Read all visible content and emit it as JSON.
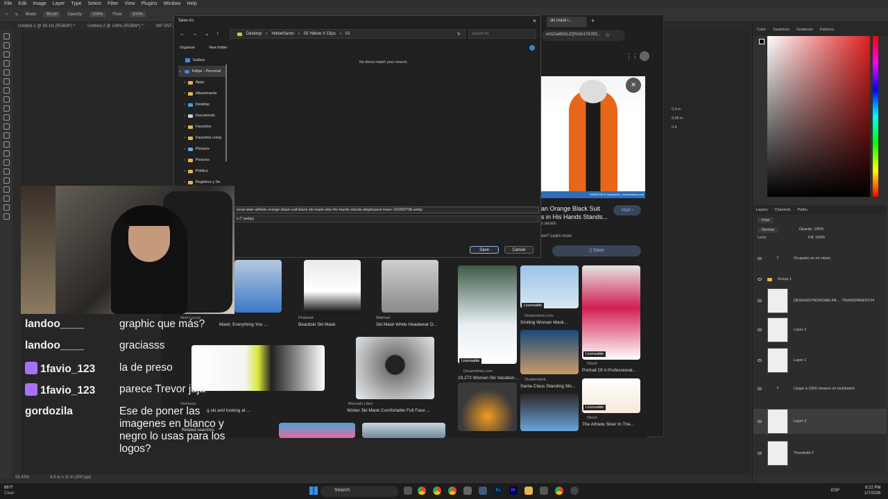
{
  "ps": {
    "menu": [
      "File",
      "Edit",
      "Image",
      "Layer",
      "Type",
      "Select",
      "Filter",
      "View",
      "Plugins",
      "Window",
      "Help"
    ],
    "opts": [
      "Mode:",
      "Brush",
      "Opacity:",
      "100%",
      "Flow:",
      "100%"
    ],
    "docs": [
      "Untitled-1 @ 39.1% (RGB/8*) *",
      "Untitled-2 @ 149% (RGB/8*) *",
      "WP SNT..."
    ],
    "status_zoom": "55.42%",
    "status_doc": "8.5 in x 11 in (300 ppi)",
    "panel_tabs": [
      "Color",
      "Swatches",
      "Gradients",
      "Patterns"
    ],
    "layers_tabs": [
      "Layers",
      "Channels",
      "Paths"
    ],
    "layers_kind": "Kind",
    "blend": "Normal",
    "opacity": "Opacity: 100%",
    "lock": "Lock:",
    "fill": "Fill: 100%",
    "layers": [
      "Ocupado en mi vision",
      "Group 1",
      "DESIGNSYNDROME-PA... -TRANSPARENT24",
      "Layer 2",
      "Layer 1",
      "Llegar a 1000 viewers en kick/twitch",
      "Layer 3",
      "Threshold 2"
    ],
    "props": [
      "0.6 in",
      "5.85 in",
      "0.4"
    ]
  },
  "dialog": {
    "title": "Save As",
    "path": [
      "Desktop",
      "YellowSanto",
      "05 Yellow X Clips",
      "01"
    ],
    "search_placeholder": "Search 01",
    "organize": "Organize",
    "new_folder": "New folder",
    "empty": "No items match your search.",
    "tree": [
      "Gallery",
      "Felipe - Personal",
      "Apps",
      "Attachments",
      "Desktop",
      "Documents",
      "Favoritos",
      "Favoritos comp",
      "Pictures",
      "Pictures",
      "Público",
      "Registros y Se"
    ],
    "filename": "ional-skier-athlete-orange-black-suit-black-ski-mask-skis-his-hands-stands-displeased-mass-159350798.webp",
    "filetype": "s (*.webp)",
    "save": "Save",
    "cancel": "Cancel"
  },
  "browser": {
    "tab": "ski mask r...",
    "url": "ieSZoeBGILZQ%3A176783...",
    "title": "an Orange Black Suit",
    "title2": "s in His Hands Stands...",
    "details": "s details",
    "visit": "Visit",
    "save": "Save",
    "learn": "om? Learn more",
    "watermark": "159350798 © lanikovich1 | Dreamstime.com"
  },
  "results": [
    {
      "src": "Nest Luxury",
      "cap": "Mask: Everything You ..."
    },
    {
      "src": "Pinterest",
      "cap": "Beardski Ski Mask"
    },
    {
      "src": "Walmart",
      "cap": "Ski Mask White Headwear D..."
    },
    {
      "src": "Vecteezy",
      "cap": "g ski and looking at ..."
    },
    {
      "src": "Mercado Libre",
      "cap": "Winter Ski Mask Comfortable Full Face ..."
    },
    {
      "src": "Dreamstime.com",
      "cap": "19,272 Woman Ski Vacation..."
    },
    {
      "src": "Dreamstime.com",
      "cap": "Smiling Woman Mask..."
    },
    {
      "src": "Shutterstock",
      "cap": "Santa Claus Standing Ski..."
    },
    {
      "src": "iStock",
      "cap": "Portrait Of A Professional..."
    },
    {
      "src": "iStock",
      "cap": "The Athlete Skier In The..."
    }
  ],
  "licensable": "Licensable",
  "related": "Related searches",
  "chat": [
    {
      "user": "landoo____",
      "msg": "graphic que más?",
      "badge": false
    },
    {
      "user": "landoo____",
      "msg": "graciasss",
      "badge": false
    },
    {
      "user": "1favio_123",
      "msg": "la de preso",
      "badge": true
    },
    {
      "user": "1favio_123",
      "msg": "parece Trevor jaja",
      "badge": true
    },
    {
      "user": "gordozila",
      "msg": "Ese de poner las imagenes en blanco y negro lo usas para los logos?",
      "badge": false
    }
  ],
  "taskbar": {
    "weather": "66°F",
    "weather2": "Clear",
    "search": "Search",
    "lang": "ESP",
    "time": "8:22 PM",
    "date": "1/7/2026"
  }
}
